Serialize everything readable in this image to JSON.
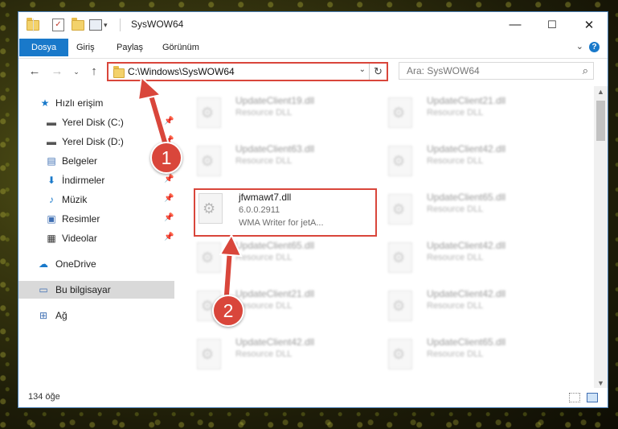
{
  "window": {
    "title": "SysWOW64",
    "controls": {
      "minimize": "—",
      "maximize": "☐",
      "close": "✕"
    }
  },
  "ribbon": {
    "tabs": [
      "Dosya",
      "Giriş",
      "Paylaş",
      "Görünüm"
    ],
    "help": "?"
  },
  "nav": {
    "address": "C:\\Windows\\SysWOW64",
    "search_placeholder": "Ara: SysWOW64"
  },
  "sidebar": {
    "items": [
      {
        "label": "Hızlı erişim",
        "icon": "star-icon"
      },
      {
        "label": "Yerel Disk (C:)",
        "icon": "drive-icon"
      },
      {
        "label": "Yerel Disk (D:)",
        "icon": "drive-icon"
      },
      {
        "label": "Belgeler",
        "icon": "documents-icon"
      },
      {
        "label": "İndirmeler",
        "icon": "download-icon"
      },
      {
        "label": "Müzik",
        "icon": "music-icon"
      },
      {
        "label": "Resimler",
        "icon": "pictures-icon"
      },
      {
        "label": "Videolar",
        "icon": "videos-icon"
      },
      {
        "label": "OneDrive",
        "icon": "cloud-icon"
      },
      {
        "label": "Bu bilgisayar",
        "icon": "computer-icon"
      },
      {
        "label": "Ağ",
        "icon": "network-icon"
      }
    ]
  },
  "files": {
    "left": [
      {
        "name": "UpdateClient19.dll",
        "desc": "Resource DLL"
      },
      {
        "name": "UpdateClient63.dll",
        "desc": "Resource DLL"
      },
      {
        "name": "jfwmawt7.dll",
        "version": "6.0.0.2911",
        "desc": "WMA Writer for jetA..."
      },
      {
        "name": "UpdateClient65.dll",
        "desc": "Resource DLL"
      },
      {
        "name": "UpdateClient21.dll",
        "desc": "Resource DLL"
      },
      {
        "name": "UpdateClient42.dll",
        "desc": "Resource DLL"
      }
    ],
    "right": [
      {
        "name": "UpdateClient21.dll",
        "desc": "Resource DLL"
      },
      {
        "name": "UpdateClient42.dll",
        "desc": "Resource DLL"
      },
      {
        "name": "UpdateClient65.dll",
        "desc": "Resource DLL"
      },
      {
        "name": "UpdateClient42.dll",
        "desc": "Resource DLL"
      },
      {
        "name": "UpdateClient42.dll",
        "desc": "Resource DLL"
      },
      {
        "name": "UpdateClient65.dll",
        "desc": "Resource DLL"
      }
    ]
  },
  "status": {
    "count": "134 öğe"
  },
  "annotations": {
    "step1": "1",
    "step2": "2",
    "color": "#d9463b"
  }
}
